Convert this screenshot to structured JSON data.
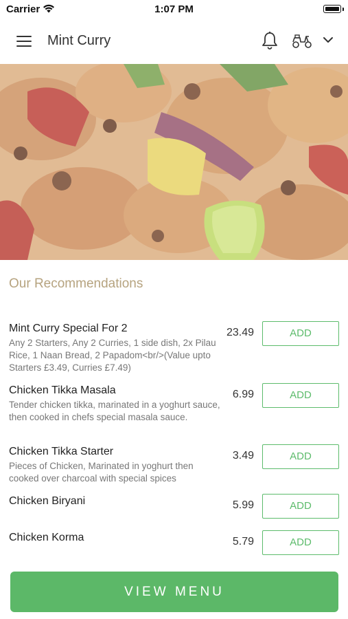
{
  "status_bar": {
    "carrier": "Carrier",
    "time": "1:07 PM"
  },
  "header": {
    "title": "Mint Curry"
  },
  "icons": {
    "menu": "hamburger-menu-icon",
    "bell": "bell-icon",
    "delivery": "scooter-icon",
    "dropdown": "chevron-down-icon"
  },
  "recommendations": {
    "title": "Our Recommendations",
    "items": [
      {
        "name": "Mint Curry Special For 2",
        "description": "Any 2 Starters, Any 2 Curries, 1 side dish, 2x Pilau Rice, 1 Naan Bread, 2 Papadom<br/>(Value upto Starters £3.49, Curries £7.49)",
        "price": "23.49",
        "add_label": "ADD"
      },
      {
        "name": "Chicken Tikka Masala",
        "description": "Tender chicken tikka, marinated in a yoghurt sauce, then cooked in chefs special masala sauce.",
        "price": "6.99",
        "add_label": "ADD"
      },
      {
        "name": "Chicken Tikka Starter",
        "description": "Pieces of Chicken, Marinated in yoghurt then cooked over charcoal with special spices",
        "price": "3.49",
        "add_label": "ADD"
      },
      {
        "name": "Chicken Biryani",
        "description": "",
        "price": "5.99",
        "add_label": "ADD"
      },
      {
        "name": "Chicken Korma",
        "description": "",
        "price": "5.79",
        "add_label": "ADD"
      }
    ]
  },
  "footer": {
    "view_menu_label": "VIEW MENU"
  },
  "colors": {
    "accent_green": "#5cb868",
    "section_gold": "#b6a37f"
  }
}
